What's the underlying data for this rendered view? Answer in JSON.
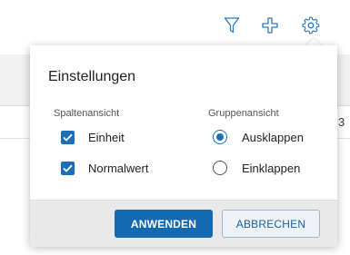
{
  "toolbar": {
    "icons": [
      "filter-icon",
      "add-icon",
      "settings-icon"
    ]
  },
  "background": {
    "cell_text": "3"
  },
  "dialog": {
    "title": "Einstellungen",
    "columns_section": {
      "label": "Spaltenansicht",
      "options": [
        {
          "label": "Einheit",
          "checked": true
        },
        {
          "label": "Normalwert",
          "checked": true
        }
      ]
    },
    "groups_section": {
      "label": "Gruppenansicht",
      "options": [
        {
          "label": "Ausklappen",
          "selected": true
        },
        {
          "label": "Einklappen",
          "selected": false
        }
      ]
    },
    "apply_label": "ANWENDEN",
    "cancel_label": "ABBRECHEN"
  },
  "colors": {
    "accent": "#1569b3",
    "icon": "#2a7bc0",
    "footer": "#e9e9e9"
  }
}
